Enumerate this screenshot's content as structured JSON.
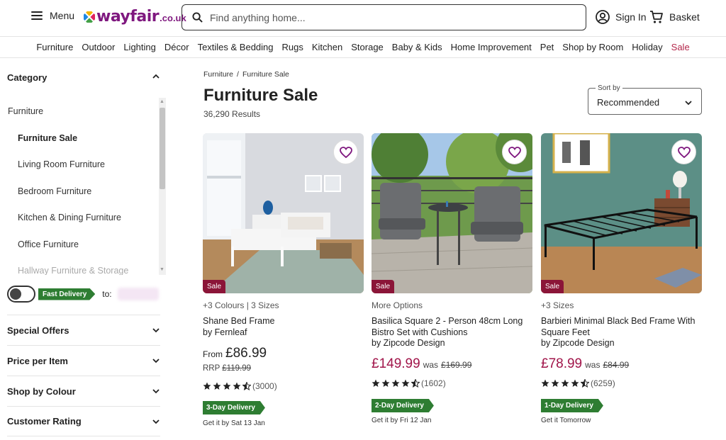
{
  "header": {
    "menu_label": "Menu",
    "brand": "wayfair",
    "tld": ".co.uk",
    "search_placeholder": "Find anything home...",
    "signin_label": "Sign In",
    "basket_label": "Basket"
  },
  "nav": [
    "Furniture",
    "Outdoor",
    "Lighting",
    "Décor",
    "Textiles & Bedding",
    "Rugs",
    "Kitchen",
    "Storage",
    "Baby & Kids",
    "Home Improvement",
    "Pet",
    "Shop by Room",
    "Holiday",
    "Sale"
  ],
  "sidebar": {
    "category_title": "Category",
    "categories": [
      "Furniture",
      "Furniture Sale",
      "Living Room Furniture",
      "Bedroom Furniture",
      "Kitchen & Dining Furniture",
      "Office Furniture",
      "Hallway Furniture & Storage"
    ],
    "fast_delivery": "Fast Delivery",
    "to_label": "to:",
    "filters": [
      "Special Offers",
      "Price per Item",
      "Shop by Colour",
      "Customer Rating"
    ]
  },
  "breadcrumb": [
    "Furniture",
    "Furniture Sale"
  ],
  "breadcrumb_sep": "/",
  "page_title": "Furniture Sale",
  "results": "36,290 Results",
  "sort": {
    "label": "Sort by",
    "value": "Recommended"
  },
  "products": [
    {
      "options": "+3 Colours | 3 Sizes",
      "name": "Shane Bed Frame",
      "brand": "by Fernleaf",
      "from": "From",
      "price": "£86.99",
      "rrp_label": "RRP",
      "rrp_price": "£119.99",
      "reviews": "(3000)",
      "rating": 4.5,
      "delivery": "3-Day Delivery",
      "getit": "Get it by Sat 13 Jan",
      "sale": "Sale"
    },
    {
      "options": "More Options",
      "name": "Basilica Square 2 - Person 48cm Long Bistro Set with Cushions",
      "brand": "by Zipcode Design",
      "price": "£149.99",
      "was_label": "was",
      "was_price": "£169.99",
      "reviews": "(1602)",
      "rating": 4.5,
      "delivery": "2-Day Delivery",
      "getit": "Get it by Fri 12 Jan",
      "sale": "Sale"
    },
    {
      "options": "+3 Sizes",
      "name": "Barbieri Minimal Black Bed Frame With Square Feet",
      "brand": "by Zipcode Design",
      "price": "£78.99",
      "was_label": "was",
      "was_price": "£84.99",
      "reviews": "(6259)",
      "rating": 4.5,
      "delivery": "1-Day Delivery",
      "getit": "Get it Tomorrow",
      "sale": "Sale"
    }
  ],
  "colors": {
    "brand": "#7f187f",
    "sale": "#a1154a",
    "delivery": "#2e7d32",
    "badge": "#8b1538"
  }
}
